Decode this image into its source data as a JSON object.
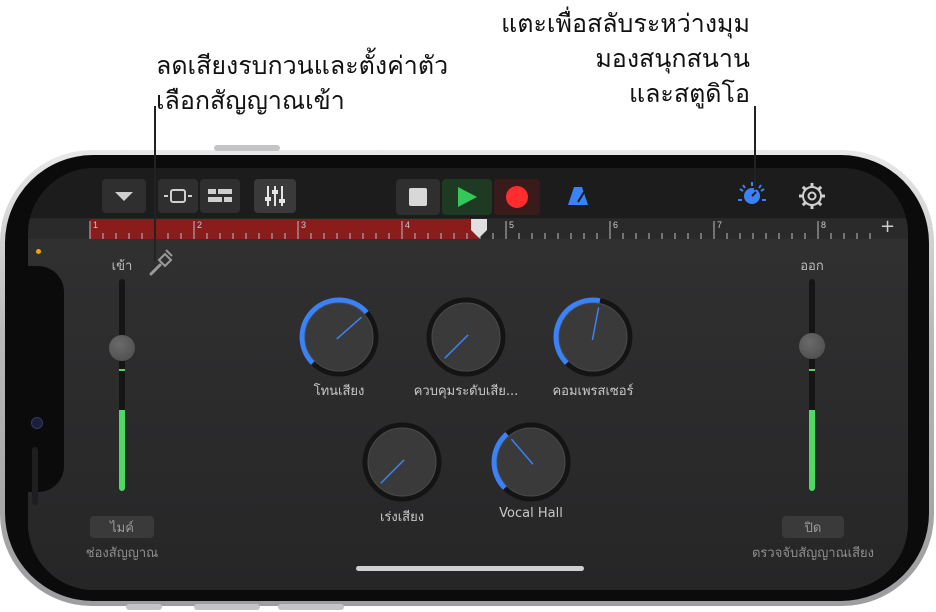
{
  "callouts": {
    "left": [
      "ลดเสียงรบกวนและตั้งค่าตัว",
      "เลือกสัญญาณเข้า"
    ],
    "right": [
      "แตะเพื่อสลับระหว่างมุม",
      "มองสนุกสนาน",
      "และสตูดิโอ"
    ]
  },
  "toolbar": {
    "icons": [
      "browser-menu-icon",
      "tracks-view-icon",
      "smart-controls-icon",
      "mixer-icon",
      "stop-icon",
      "play-icon",
      "record-icon",
      "metronome-icon",
      "view-toggle-icon",
      "settings-gear-icon"
    ],
    "colors": {
      "play": "#34c759",
      "record": "#ff2d2d",
      "metronome": "#3b82f6",
      "view_toggle": "#3b82f6"
    }
  },
  "ruler": {
    "bars": [
      "1",
      "2",
      "3",
      "4",
      "5",
      "6",
      "7",
      "8"
    ],
    "add_label": "+"
  },
  "input": {
    "label": "เข้า",
    "source_button": "ไมค์",
    "source_caption": "ช่องสัญญาณ"
  },
  "output": {
    "label": "ออก",
    "detect_button": "ปิด",
    "detect_caption": "ตรวจจับสัญญาณเสียง"
  },
  "knobs": [
    {
      "label": "โทนเสียง",
      "level": 0.68
    },
    {
      "label": "ควบคุมระดับเสีย...",
      "level": 0.0
    },
    {
      "label": "คอมเพรสเซอร์",
      "level": 0.54
    },
    {
      "label": "เร่งเสียง",
      "level": 0.0
    },
    {
      "label": "Vocal Hall",
      "level": 0.35
    }
  ],
  "meters": {
    "input_level": 0.38,
    "output_level": 0.38,
    "color": "#4cd964"
  },
  "accent_color": "#3b82f6"
}
